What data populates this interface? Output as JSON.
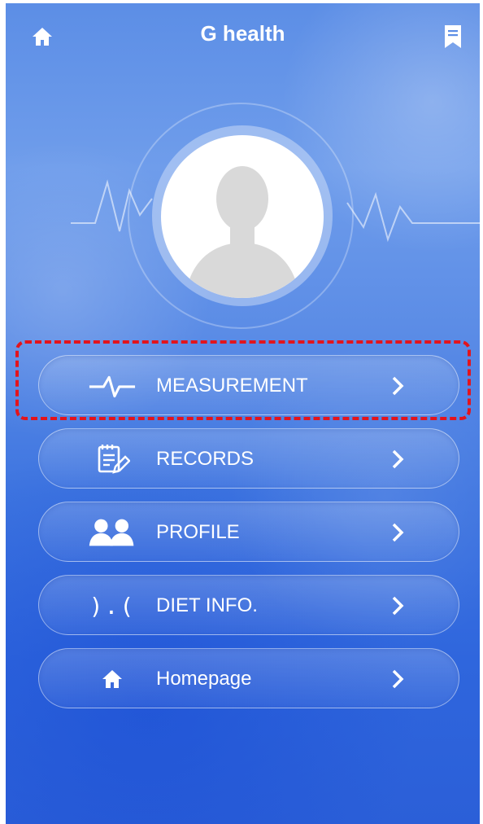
{
  "app": {
    "title": "G health"
  },
  "topbar": {
    "left_icon": "home-icon",
    "right_icon": "bookmark-icon"
  },
  "avatar": {
    "icon": "user-silhouette-icon"
  },
  "menu": {
    "items": [
      {
        "label": "MEASUREMENT",
        "icon": "heartbeat-icon"
      },
      {
        "label": "RECORDS",
        "icon": "notepad-edit-icon"
      },
      {
        "label": "PROFILE",
        "icon": "users-icon"
      },
      {
        "label": "DIET INFO.",
        "icon_text": ").("
      },
      {
        "label": "Homepage",
        "icon": "home-icon"
      }
    ]
  },
  "colors": {
    "highlight": "#e3141c",
    "background_top": "#5c8ee6",
    "background_bottom": "#2b5fd8"
  }
}
